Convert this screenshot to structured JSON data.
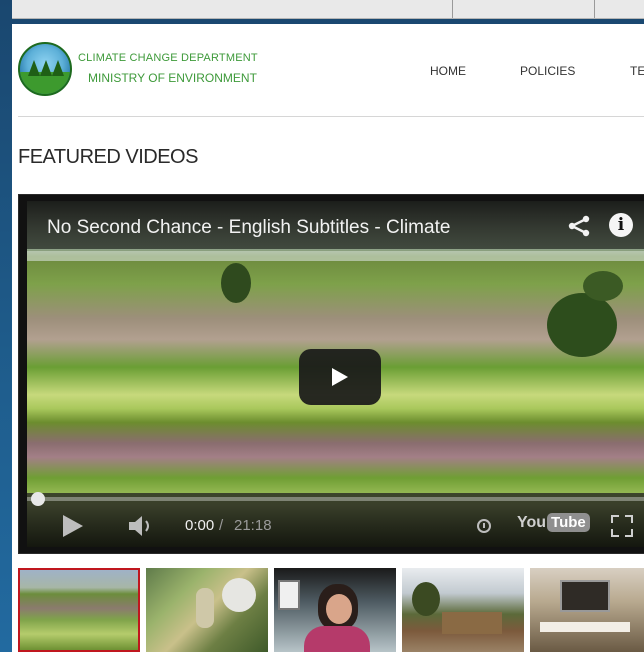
{
  "site": {
    "org_line1": "CLIMATE CHANGE DEPARTMENT",
    "org_line2": "MINISTRY OF ENVIRONMENT",
    "logo_icon": "emblem-logo-icon"
  },
  "nav": {
    "items": [
      {
        "label": "HOME"
      },
      {
        "label": "POLICIES"
      },
      {
        "label": "TE"
      }
    ]
  },
  "section": {
    "title": "FEATURED VIDEOS"
  },
  "video": {
    "title": "No Second Chance - English Subtitles - Climate",
    "current_time": "0:00",
    "separator": "/",
    "duration": "21:18",
    "progress_fraction": 0.0,
    "platform_you": "You",
    "platform_tube": "Tube",
    "icons": [
      "share-icon",
      "info-icon",
      "play-icon",
      "volume-icon",
      "clock-icon",
      "fullscreen-icon"
    ]
  },
  "playlist": {
    "active_index": 0,
    "active_border_color": "#c0161e",
    "thumbnails": [
      {
        "name": "rice-field-thumbnail"
      },
      {
        "name": "farmer-thumbnail"
      },
      {
        "name": "interview-woman-thumbnail"
      },
      {
        "name": "village-thumbnail"
      },
      {
        "name": "room-screen-thumbnail"
      }
    ]
  },
  "colors": {
    "brand_green": "#3e9a3a",
    "nav_text": "#333333",
    "heading_text": "#2a2a2a"
  }
}
